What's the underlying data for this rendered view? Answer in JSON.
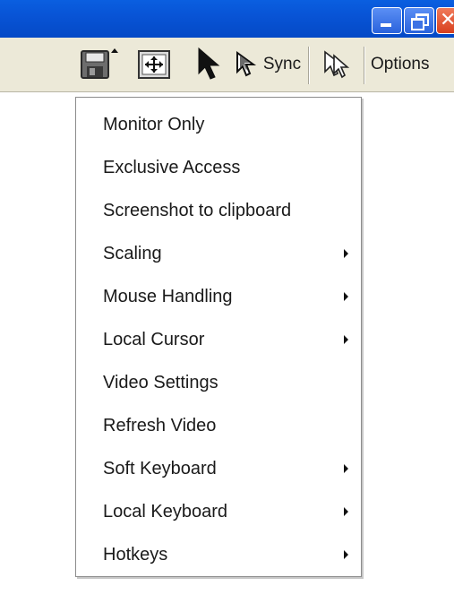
{
  "window": {
    "title_buttons": [
      "minimize-icon",
      "restore-icon",
      "close-icon"
    ]
  },
  "toolbar": {
    "icons": [
      "save-icon",
      "fit-window-icon",
      "pointer-icon",
      "sync-cursor-icon",
      "single-cursor-icon"
    ],
    "sync_label": "Sync",
    "options_label": "Options"
  },
  "menu": {
    "items": [
      {
        "label": "Monitor Only",
        "submenu": false
      },
      {
        "label": "Exclusive Access",
        "submenu": false
      },
      {
        "label": "Screenshot to clipboard",
        "submenu": false
      },
      {
        "label": "Scaling",
        "submenu": true
      },
      {
        "label": "Mouse Handling",
        "submenu": true
      },
      {
        "label": "Local Cursor",
        "submenu": true
      },
      {
        "label": "Video Settings",
        "submenu": false
      },
      {
        "label": "Refresh Video",
        "submenu": false
      },
      {
        "label": "Soft Keyboard",
        "submenu": true
      },
      {
        "label": "Local Keyboard",
        "submenu": true
      },
      {
        "label": "Hotkeys",
        "submenu": true
      }
    ]
  },
  "colors": {
    "titlebar": "#0854d6",
    "toolbar": "#ece9d8",
    "close_button": "#d8401e"
  }
}
